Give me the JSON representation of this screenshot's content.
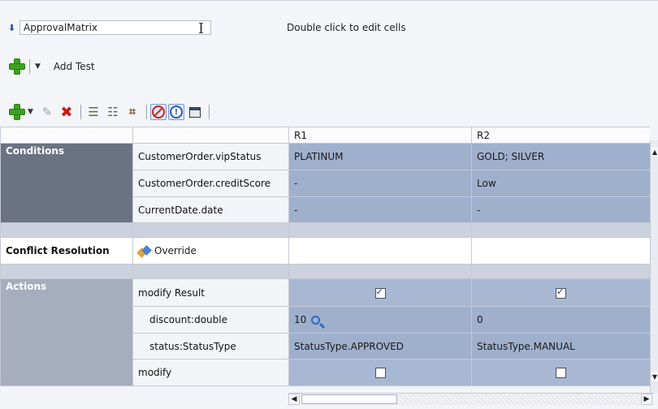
{
  "header": {
    "collapse_icon": "double-chevron-down-icon",
    "name_value": "ApprovalMatrix",
    "hint": "Double click to edit cells"
  },
  "add_test": {
    "label": "Add Test",
    "icon": "add-plus-icon"
  },
  "toolbar": {
    "icons": [
      "add-plus-icon",
      "dropdown-arrow-icon",
      "edit-pencil-icon",
      "delete-x-icon",
      "add-column-icon",
      "add-columns-icon",
      "find-icon",
      "disable-icon",
      "warning-icon",
      "dialog-icon"
    ]
  },
  "columns": [
    "",
    "",
    "R1",
    "R2"
  ],
  "sections": {
    "conditions": {
      "label": "Conditions",
      "rows": [
        {
          "name": "CustomerOrder.vipStatus",
          "r1": "PLATINUM",
          "r2": "GOLD; SILVER"
        },
        {
          "name": "CustomerOrder.creditScore",
          "r1": "-",
          "r2": "Low"
        },
        {
          "name": "CurrentDate.date",
          "r1": "-",
          "r2": "-"
        }
      ]
    },
    "conflict": {
      "label": "Conflict Resolution",
      "value": "Override"
    },
    "actions": {
      "label": "Actions",
      "rows": [
        {
          "name": "modify Result",
          "type": "checkbox",
          "r1": true,
          "r2": true
        },
        {
          "name": "discount:double",
          "type": "value",
          "r1": "10",
          "r2": "0"
        },
        {
          "name": "status:StatusType",
          "type": "value",
          "r1": "StatusType.APPROVED",
          "r2": "StatusType.MANUAL"
        },
        {
          "name": "modify",
          "type": "checkbox",
          "r1": false,
          "r2": false
        }
      ]
    }
  }
}
